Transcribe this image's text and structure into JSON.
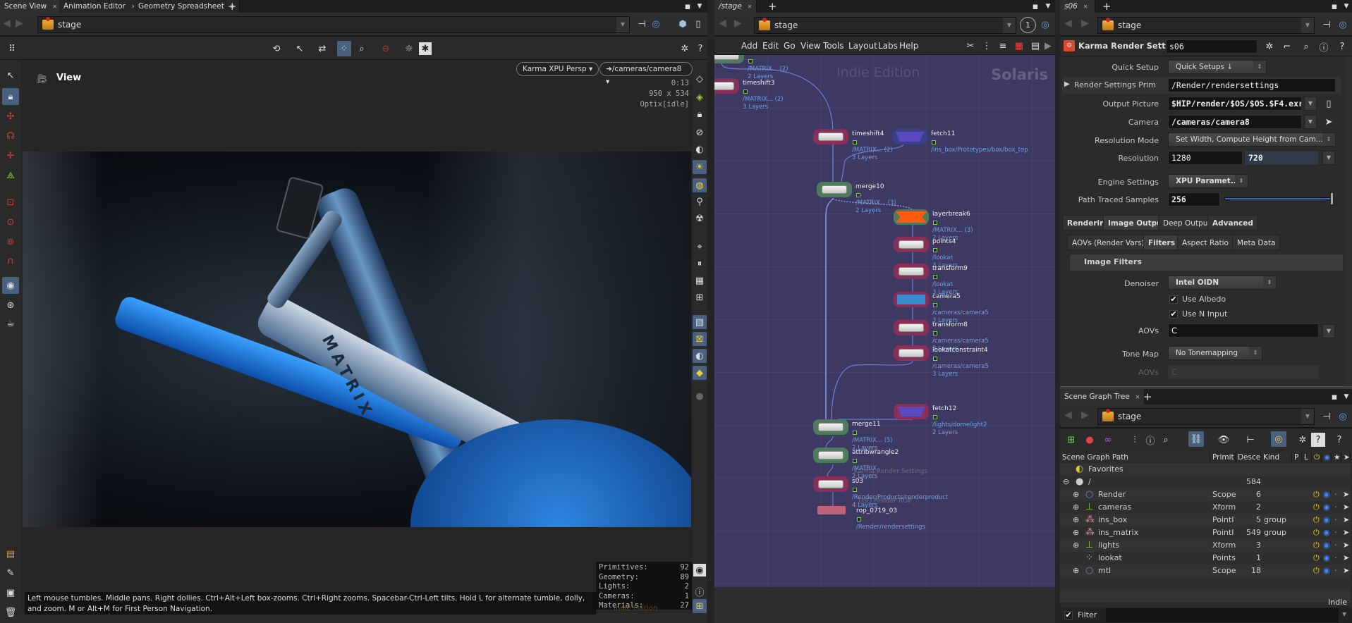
{
  "scene_view": {
    "tabs": [
      "Scene View",
      "Animation Editor",
      "Geometry Spreadsheet"
    ],
    "path": "stage",
    "title": "View",
    "renderer_menu": "Karma XPU  Persp",
    "camera_menu": "/cameras/camera8",
    "render_time": "0:13",
    "render_resolution": "950 x 534",
    "render_status": "Optix[idle]",
    "status_message": "Left mouse tumbles. Middle pans. Right dollies. Ctrl+Alt+Left box-zooms. Ctrl+Right zooms. Spacebar-Ctrl-Left tilts. Hold L for alternate tumble, dolly, and zoom. M or Alt+M for First Person Navigation.",
    "stats": [
      {
        "label": "Primitives:",
        "value": "92"
      },
      {
        "label": "Geometry:",
        "value": "89"
      },
      {
        "label": "Lights:",
        "value": "2"
      },
      {
        "label": "Cameras:",
        "value": "1"
      },
      {
        "label": "Materials:",
        "value": "27"
      }
    ],
    "watermark": "Indie Edition",
    "product_text": "MATRIX"
  },
  "network": {
    "tab": "/stage",
    "path": "stage",
    "update_mode": "1",
    "menu": [
      "Add",
      "Edit",
      "Go",
      "View",
      "Tools",
      "Layout",
      "Labs",
      "Help"
    ],
    "watermark": "Indie Edition",
    "context": "Solaris",
    "nodes": [
      {
        "name": "",
        "sub1": "/MATRIX... (2)",
        "sub2": "2 Layers",
        "color": "#4e7a5e"
      },
      {
        "name": "timeshift3",
        "sub1": "/MATRIX... (2)",
        "sub2": "3 Layers",
        "color": "#8a2f5a"
      },
      {
        "name": "timeshift4",
        "sub1": "/MATRIX... (2)",
        "sub2": "3 Layers",
        "color": "#8a2f5a"
      },
      {
        "name": "fetch11",
        "sub1": "/ins_box/Prototypes/box/box_top",
        "sub2": "",
        "color": "#3a3f8a"
      },
      {
        "name": "merge10",
        "sub1": "/MATRIX... (3)",
        "sub2": "2 Layers",
        "color": "#4e7a5e"
      },
      {
        "name": "layerbreak6",
        "sub1": "/MATRIX... (3)",
        "sub2": "2 Layers",
        "color": "#4e7a5e"
      },
      {
        "name": "points4",
        "sub1": "/lookat",
        "sub2": "3 Layers",
        "color": "#8a2f5a"
      },
      {
        "name": "transform9",
        "sub1": "/lookat",
        "sub2": "3 Layers",
        "color": "#8a2f5a"
      },
      {
        "name": "camera5",
        "sub1": "/cameras/camera5",
        "sub2": "3 Layers",
        "color": "#8a2f5a"
      },
      {
        "name": "transform8",
        "sub1": "/cameras/camera5",
        "sub2": "3 Layers",
        "color": "#8a2f5a"
      },
      {
        "name": "lookatconstraint4",
        "sub1": "/cameras/camera5",
        "sub2": "3 Layers",
        "color": "#8a2f5a"
      },
      {
        "name": "fetch12",
        "sub1": "/lights/domelight2",
        "sub2": "2 Layers",
        "color": "#8a2f5a"
      },
      {
        "name": "merge11",
        "sub1": "/MATRIX... (5)",
        "sub2": "2 Layers",
        "color": "#4e7a5e"
      },
      {
        "name": "attribwrangle2",
        "sub1": "/MATRIX",
        "sub2": "2 Layers",
        "color": "#4e7a5e"
      },
      {
        "name": "s03",
        "sub1": "/Render/Products/renderproduct",
        "sub2": "4 Layers",
        "color": "#8a2f5a",
        "comment": "Karma Render Settings"
      },
      {
        "name": "rop_0719_03",
        "sub1": "/Render/rendersettings",
        "sub2": "",
        "color": "#c0607a",
        "comment": "USD Render ROP"
      }
    ]
  },
  "params": {
    "tab": "s06",
    "path": "stage",
    "node_type": "Karma Render Settings",
    "node_name": "s06",
    "quick_setup": {
      "label": "Quick Setup",
      "value": "Quick Setups"
    },
    "render_settings_prim": {
      "label": "Render Settings Prim",
      "value": "/Render/rendersettings"
    },
    "output_picture": {
      "label": "Output Picture",
      "value": "$HIP/render/$OS/$OS.$F4.exr"
    },
    "camera": {
      "label": "Camera",
      "value": "/cameras/camera8"
    },
    "resolution_mode": {
      "label": "Resolution Mode",
      "value": "Set Width, Compute Height from Cam..."
    },
    "resolution": {
      "label": "Resolution",
      "width": "1280",
      "height": "720"
    },
    "engine_settings": {
      "label": "Engine Settings",
      "value": "XPU Paramet..."
    },
    "path_traced_samples": {
      "label": "Path Traced Samples",
      "value": "256",
      "slider_fraction": 1.0
    },
    "tabs": [
      "Rendering",
      "Image Output",
      "Deep Output",
      "Advanced"
    ],
    "active_tab": "Image Output",
    "subtabs": [
      "AOVs (Render Vars)",
      "Filters",
      "Aspect Ratio",
      "Meta Data"
    ],
    "active_subtab": "Filters",
    "section": "Image Filters",
    "denoiser": {
      "label": "Denoiser",
      "value": "Intel OIDN"
    },
    "use_albedo": {
      "label": "Use Albedo",
      "checked": true
    },
    "use_n_input": {
      "label": "Use N Input",
      "checked": true
    },
    "aovs": {
      "label": "AOVs",
      "value": "C"
    },
    "tone_map": {
      "label": "Tone Map",
      "value": "No Tonemapping"
    },
    "tone_aovs": {
      "label": "AOVs",
      "value": "C"
    }
  },
  "scene_graph": {
    "tab": "Scene Graph Tree",
    "path": "stage",
    "columns": [
      "Scene Graph Path",
      "Primit",
      "Desce",
      "Kind",
      "P",
      "L"
    ],
    "rows": [
      {
        "name": "Favorites",
        "type": "",
        "desc": "",
        "kind": "",
        "level": 0,
        "icon": "favorites-icon"
      },
      {
        "name": "/",
        "type": "",
        "desc": "584",
        "kind": "",
        "level": 0,
        "icon": "root-sphere-icon"
      },
      {
        "name": "Render",
        "type": "Scope",
        "desc": "6",
        "kind": "",
        "level": 1,
        "icon": "scope-icon"
      },
      {
        "name": "cameras",
        "type": "Xform",
        "desc": "2",
        "kind": "",
        "level": 1,
        "icon": "xform-icon"
      },
      {
        "name": "ins_box",
        "type": "PointI",
        "desc": "5",
        "kind": "group",
        "level": 1,
        "icon": "pointinstancer-icon"
      },
      {
        "name": "ins_matrix",
        "type": "PointI",
        "desc": "549",
        "kind": "group",
        "level": 1,
        "icon": "pointinstancer-icon"
      },
      {
        "name": "lights",
        "type": "Xform",
        "desc": "3",
        "kind": "",
        "level": 1,
        "icon": "xform-icon"
      },
      {
        "name": "lookat",
        "type": "Points",
        "desc": "1",
        "kind": "",
        "level": 1,
        "icon": "points-icon"
      },
      {
        "name": "mtl",
        "type": "Scope",
        "desc": "18",
        "kind": "",
        "level": 1,
        "icon": "scope-icon"
      }
    ],
    "edition": "Indie",
    "filter_label": "Filter",
    "filter_checked": true
  },
  "colors": {
    "network_bg": "#3e3962",
    "accent": "#4a6080",
    "wire": "#6a7fd8"
  }
}
